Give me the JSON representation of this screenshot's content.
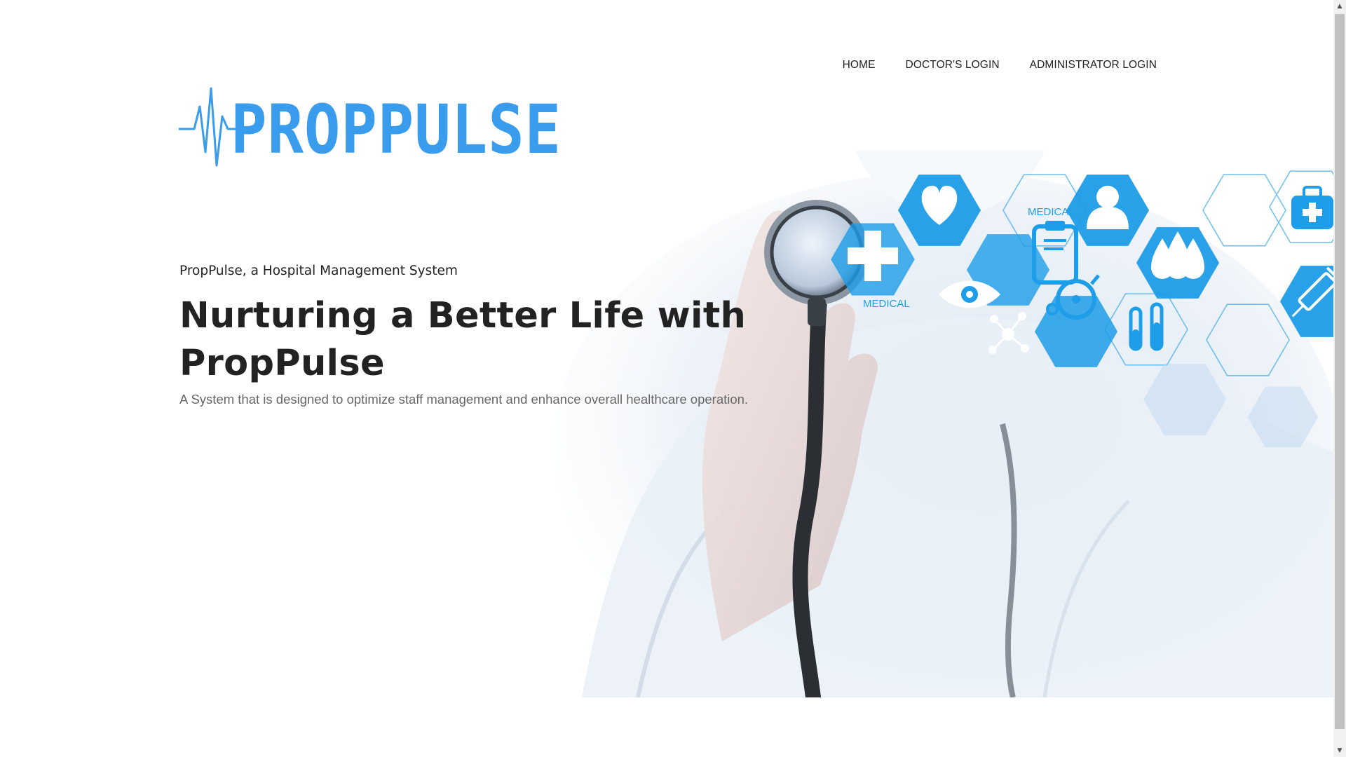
{
  "nav": {
    "items": [
      {
        "label": "HOME"
      },
      {
        "label": "DOCTOR'S LOGIN"
      },
      {
        "label": "ADMINISTRATOR LOGIN"
      }
    ]
  },
  "logo": {
    "text": "PROPPULSE",
    "color": "#3a9cec"
  },
  "hero": {
    "tagline": "PropPulse, a Hospital Management System",
    "headline": "Nurturing a Better Life with PropPulse",
    "description": "A System that is designed to optimize staff management and enhance overall healthcare operation."
  },
  "illustration": {
    "labels": [
      "MEDICAL",
      "MEDICAL"
    ],
    "icons": [
      "heart-icon",
      "clipboard-icon",
      "user-icon",
      "medical-cross-icon",
      "eye-icon",
      "droplets-icon",
      "first-aid-kit-icon",
      "wheelchair-icon",
      "molecule-icon",
      "test-tubes-icon",
      "syringe-icon"
    ],
    "accent": "#1a9be6"
  },
  "scrollbar": {
    "up": "▲",
    "down": "▼"
  }
}
